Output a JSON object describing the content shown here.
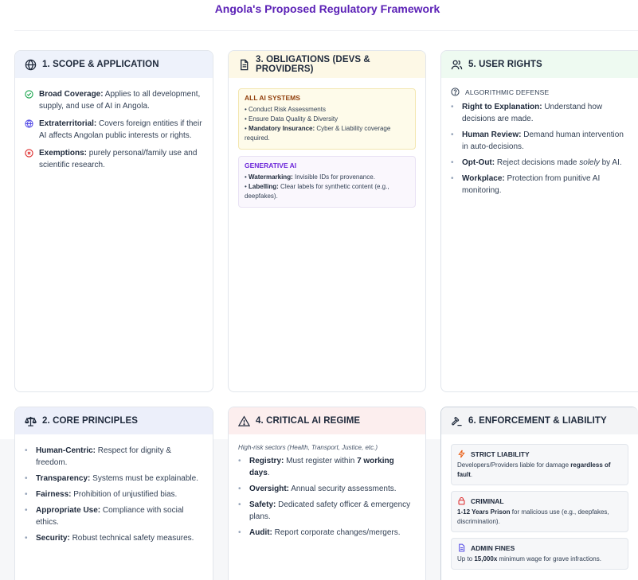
{
  "title": "Angola's Proposed Regulatory Framework",
  "scope": {
    "heading": "1. SCOPE & APPLICATION",
    "items": [
      {
        "label": "Broad Coverage:",
        "text": " Applies to all development, supply, and use of AI in Angola.",
        "icon": "check-circle-icon"
      },
      {
        "label": "Extraterritorial:",
        "text": " Covers foreign entities if their AI affects Angolan public interests or rights.",
        "icon": "globe-icon"
      },
      {
        "label": "Exemptions:",
        "text": " purely personal/family use and scientific research.",
        "icon": "x-circle-icon"
      }
    ]
  },
  "obligations": {
    "heading": "3. OBLIGATIONS (DEVS & PROVIDERS)",
    "all_ai": {
      "title": "ALL AI SYSTEMS",
      "line1": "• Conduct Risk Assessments",
      "line2": "• Ensure Data Quality & Diversity",
      "line3_bullet": "• ",
      "line3_label": "Mandatory Insurance:",
      "line3_text": " Cyber & Liability coverage required."
    },
    "generative": {
      "title": "GENERATIVE AI",
      "line1_bullet": "• ",
      "line1_label": "Watermarking:",
      "line1_text": " Invisible IDs for provenance.",
      "line2_bullet": "• ",
      "line2_label": "Labelling:",
      "line2_text": " Clear labels for synthetic content (e.g., deepfakes)."
    }
  },
  "user_rights": {
    "heading": "5. USER RIGHTS",
    "subheading": "ALGORITHMIC DEFENSE",
    "items": [
      {
        "label": "Right to Explanation:",
        "text": " Understand how decisions are made."
      },
      {
        "label": "Human Review:",
        "text": " Demand human intervention in auto-decisions."
      },
      {
        "label": "Opt-Out:",
        "text_before": " Reject decisions made ",
        "emphasis": "solely",
        "text_after": " by AI."
      },
      {
        "label": "Workplace:",
        "text": " Protection from punitive AI monitoring."
      }
    ]
  },
  "principles": {
    "heading": "2. CORE PRINCIPLES",
    "items": [
      {
        "label": "Human-Centric:",
        "text": " Respect for dignity & freedom."
      },
      {
        "label": "Transparency:",
        "text": " Systems must be explainable."
      },
      {
        "label": "Fairness:",
        "text": " Prohibition of unjustified bias."
      },
      {
        "label": "Appropriate Use:",
        "text": " Compliance with social ethics."
      },
      {
        "label": "Security:",
        "text": " Robust technical safety measures."
      }
    ]
  },
  "critical": {
    "heading": "4. CRITICAL AI REGIME",
    "note": "High-risk sectors (Health, Transport, Justice, etc.)",
    "items": [
      {
        "label": "Registry:",
        "text_before": " Must register within ",
        "strong": "7 working days",
        "text_after": "."
      },
      {
        "label": "Oversight:",
        "text": " Annual security assessments."
      },
      {
        "label": "Safety:",
        "text": " Dedicated safety officer & emergency plans."
      },
      {
        "label": "Audit:",
        "text": " Report corporate changes/mergers."
      }
    ]
  },
  "enforcement": {
    "heading": "6. ENFORCEMENT & LIABILITY",
    "strict": {
      "title": "STRICT LIABILITY",
      "text_before": "Developers/Providers liable for damage ",
      "strong": "regardless of fault",
      "text_after": "."
    },
    "criminal": {
      "title": "CRIMINAL",
      "strong": "1-12 Years Prison",
      "text_after": " for malicious use (e.g., deepfakes, discrimination)."
    },
    "fines": {
      "title": "ADMIN FINES",
      "text_before": "Up to ",
      "strong": "15,000x",
      "text_after": " minimum wage for grave infractions."
    }
  },
  "colors": {
    "title": "#5b21b6",
    "check": "#16a34a",
    "globe": "#4f46e5",
    "exempt": "#dc2626",
    "bolt": "#ea580c",
    "lock": "#dc2626",
    "doc": "#4f46e5"
  }
}
